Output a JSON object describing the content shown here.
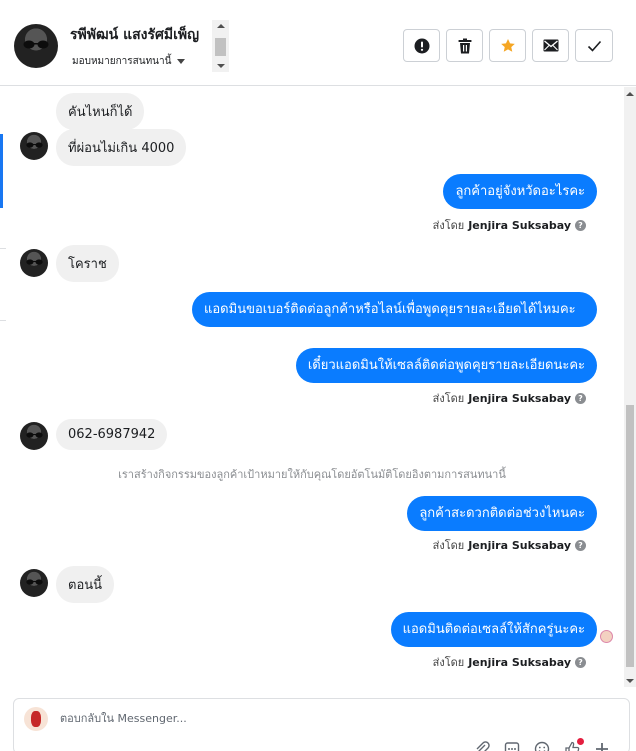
{
  "header": {
    "contact_name": "รพีพัฒน์ แสงรัศมีเพ็ญ",
    "assign_label": "มอบหมายการสนทนานี้",
    "actions": [
      {
        "name": "mark-spam-button",
        "icon": "exclamation-circle-icon"
      },
      {
        "name": "delete-button",
        "icon": "trash-icon"
      },
      {
        "name": "star-button",
        "icon": "star-icon"
      },
      {
        "name": "mark-unread-button",
        "icon": "envelope-icon"
      },
      {
        "name": "mark-done-button",
        "icon": "check-icon"
      }
    ]
  },
  "messages": {
    "m1": "คันไหนก็ได้",
    "m2": "ที่ผ่อนไม่เกิน 4000",
    "m3": "ลูกค้าอยู่จังหวัดอะไรคะ",
    "m4": "โคราช",
    "m5": "แอดมินขอเบอร์ติดต่อลูกค้าหรือไลน์เพื่อพูดคุยรายละเอียดได้ไหมคะ",
    "m6": "เดี๋ยวแอดมินให้เซลล์ติดต่อพูดคุยรายละเอียดนะคะ",
    "m7": "062-6987942",
    "m8": "ลูกค้าสะดวกติดต่อช่วงไหนคะ",
    "m9": "ตอนนี้",
    "m10": "แอดมินติดต่อเซลล์ให้สักครู่นะคะ"
  },
  "sent_by": {
    "prefix": "ส่งโดย",
    "agent": "Jenjira Suksabay",
    "help": "?"
  },
  "system_note": "เราสร้างกิจกรรมของลูกค้าเป้าหมายให้กับคุณโดยอัตโนมัติโดยอิงตามการสนทนานี้",
  "composer": {
    "placeholder": "ตอบกลับใน Messenger...",
    "tools": [
      "paperclip-icon",
      "template-icon",
      "emoji-icon",
      "thumbs-up-icon",
      "more-icon"
    ]
  },
  "colors": {
    "outgoing_bubble": "#0a7cff",
    "incoming_bubble": "#f0f0f0",
    "star": "#f5a623",
    "accent": "#1877f2"
  }
}
